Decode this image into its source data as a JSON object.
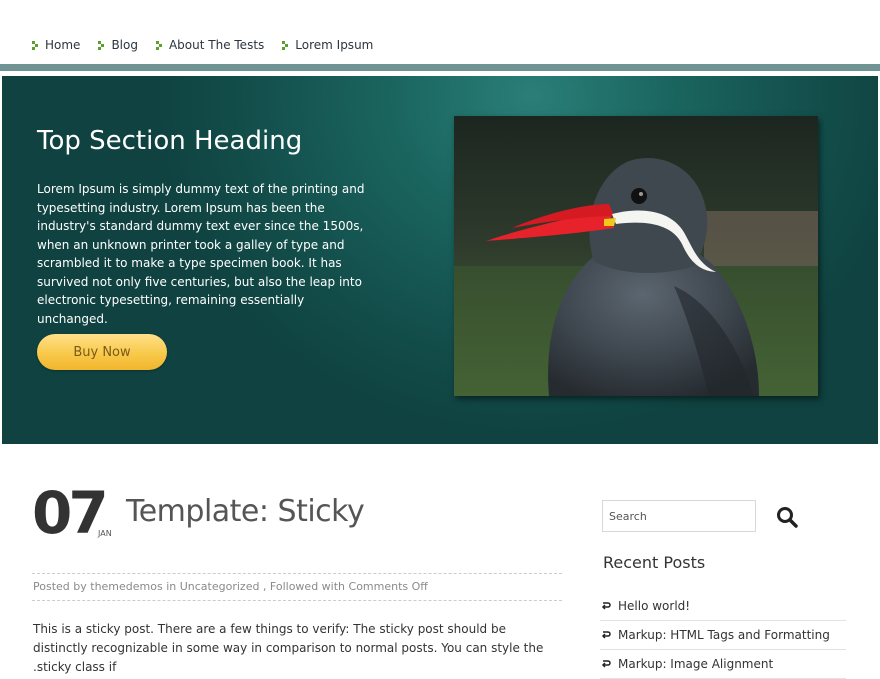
{
  "nav": {
    "items": [
      "Home",
      "Blog",
      "About The Tests",
      "Lorem Ipsum"
    ]
  },
  "hero": {
    "heading": "Top Section Heading",
    "text": "Lorem Ipsum is simply dummy text of the printing and typesetting industry. Lorem Ipsum has been the industry's standard dummy text ever since the 1500s, when an unknown printer took a galley of type and scrambled it to make a type specimen book. It has survived not only five centuries, but also the leap into electronic typesetting, remaining essentially unchanged.",
    "button": "Buy Now"
  },
  "post": {
    "day": "07",
    "month": "JAN",
    "title": "Template: Sticky",
    "meta": "Posted by themedemos in Uncategorized , Followed with Comments Off",
    "excerpt": "This is a sticky post. There are a few things to verify: The sticky post should be distinctly recognizable in some way in comparison to normal posts. You can style the .sticky class if"
  },
  "sidebar": {
    "search_placeholder": "Search",
    "recent_heading": "Recent Posts",
    "recent": [
      "Hello world!",
      "Markup: HTML Tags and Formatting",
      "Markup: Image Alignment"
    ]
  },
  "colors": {
    "hero_bg": "#134e4b",
    "nav_bar": "#6f9493",
    "button": "#f8c94a"
  }
}
